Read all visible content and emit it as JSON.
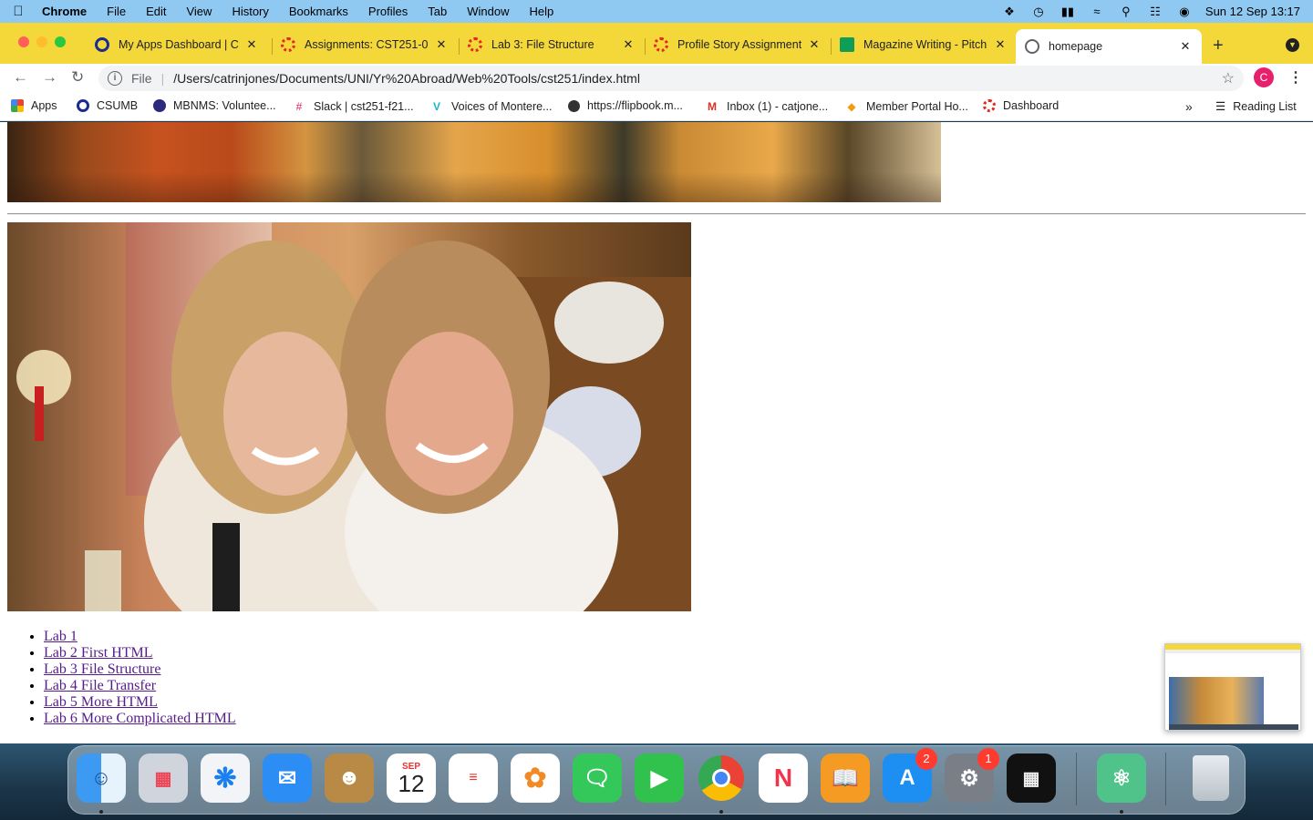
{
  "menubar": {
    "app": "Chrome",
    "items": [
      "File",
      "Edit",
      "View",
      "History",
      "Bookmarks",
      "Profiles",
      "Tab",
      "Window",
      "Help"
    ],
    "clock": "Sun 12 Sep  13:17"
  },
  "tabs": [
    {
      "label": "My Apps Dashboard | CS",
      "icon": "okta-icon",
      "color": "#1a2d8f"
    },
    {
      "label": "Assignments: CST251-0",
      "icon": "canvas-icon",
      "color": "#e0281c"
    },
    {
      "label": "Lab 3: File Structure",
      "icon": "canvas-icon",
      "color": "#e0281c"
    },
    {
      "label": "Profile Story Assignment",
      "icon": "canvas-icon",
      "color": "#e0281c"
    },
    {
      "label": "Magazine Writing - Pitch",
      "icon": "sheets-icon",
      "color": "#0f9d58"
    },
    {
      "label": "homepage",
      "icon": "globe-icon",
      "color": "#5f6368",
      "active": true
    }
  ],
  "toolbar": {
    "scheme": "File",
    "url": "/Users/catrinjones/Documents/UNI/Yr%20Abroad/Web%20Tools/cst251/index.html",
    "profile_initial": "C"
  },
  "bookmarks": [
    {
      "label": "Apps",
      "icon": "apps-grid-icon"
    },
    {
      "label": "CSUMB",
      "icon": "okta-icon"
    },
    {
      "label": "MBNMS: Voluntee...",
      "icon": "noaa-icon"
    },
    {
      "label": "Slack | cst251-f21...",
      "icon": "slack-icon"
    },
    {
      "label": "Voices of Montere...",
      "icon": "v-icon"
    },
    {
      "label": "https://flipbook.m...",
      "icon": "globe-icon"
    },
    {
      "label": "Inbox (1) - catjone...",
      "icon": "gmail-icon"
    },
    {
      "label": "Member Portal Ho...",
      "icon": "portal-icon"
    },
    {
      "label": "Dashboard",
      "icon": "canvas-icon"
    }
  ],
  "reading_list": "Reading List",
  "page": {
    "labs": [
      "Lab 1",
      "Lab 2 First HTML",
      "Lab 3 File Structure",
      "Lab 4 File Transfer",
      "Lab 5 More HTML",
      "Lab 6 More Complicated HTML"
    ]
  },
  "dock": {
    "calendar_month": "SEP",
    "calendar_day": "12",
    "appstore_badge": "2",
    "settings_badge": "1",
    "apps": [
      "finder-icon",
      "launchpad-icon",
      "safari-icon",
      "mail-icon",
      "contacts-icon",
      "calendar-icon",
      "reminders-icon",
      "photos-icon",
      "messages-icon",
      "facetime-icon",
      "chrome-icon",
      "news-icon",
      "books-icon",
      "appstore-icon",
      "system-preferences-icon",
      "mission-control-icon",
      "atom-icon",
      "trash-icon"
    ]
  }
}
